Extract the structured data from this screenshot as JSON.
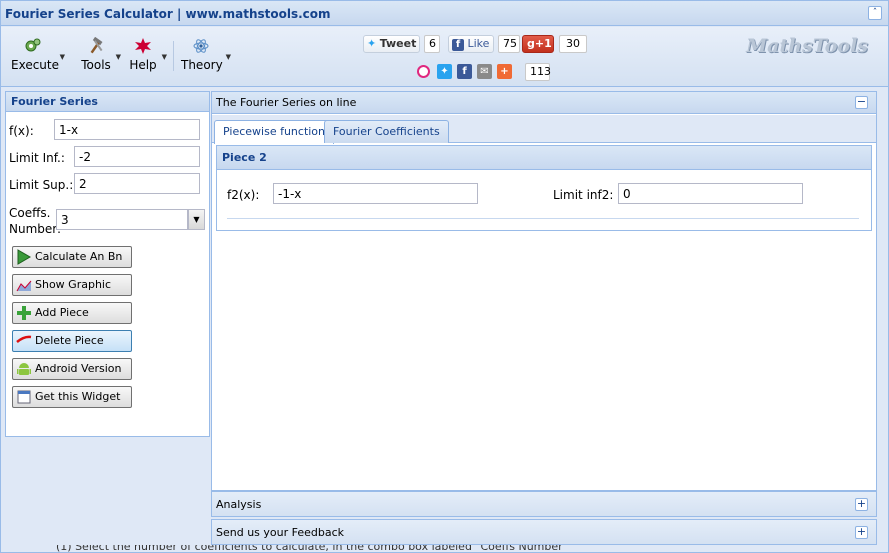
{
  "window": {
    "title": "Fourier Series Calculator | www.mathstools.com"
  },
  "toolbar": {
    "buttons": [
      {
        "label": "Execute",
        "icon": "execute-gears-icon"
      },
      {
        "label": "Tools",
        "icon": "tools-hammer-icon"
      },
      {
        "label": "Help",
        "icon": "help-burst-icon"
      },
      {
        "label": "Theory",
        "icon": "theory-atom-icon"
      }
    ]
  },
  "social": {
    "tweet_label": "Tweet",
    "tweet_count": "6",
    "like_label": "Like",
    "like_count": "75",
    "gplus_label": "+1",
    "gplus_count": "30",
    "share_count": "113"
  },
  "logo": {
    "text": "MathsTools"
  },
  "left": {
    "title": "Fourier Series",
    "fx_label": "f(x):",
    "fx_value": "1-x",
    "inf_label": "Limit Inf.:",
    "inf_value": "-2",
    "sup_label": "Limit Sup.:",
    "sup_value": "2",
    "coeffs_label_1": "Coeffs.",
    "coeffs_label_2": "Number:",
    "coeffs_value": "3",
    "buttons": [
      "Calculate An Bn",
      "Show Graphic",
      "Add Piece",
      "Delete Piece",
      "Android Version",
      "Get this Widget"
    ]
  },
  "main": {
    "title": "The Fourier Series on line",
    "tabs": [
      "Piecewise function",
      "Fourier Coefficients"
    ],
    "piece": {
      "title": "Piece 2",
      "f2_label": "f2(x):",
      "f2_value": "-1-x",
      "inf2_label": "Limit inf2:",
      "inf2_value": "0"
    }
  },
  "accordion": {
    "analysis": "Analysis",
    "feedback": "Send us your Feedback"
  },
  "footer": {
    "text": "(1) Select the number of coefficients to calculate, in the combo box labeled \"Coeffs Number\""
  },
  "colors": {
    "header_text": "#15428b",
    "border": "#99bbe8",
    "panel_bg": "#dfe8f6"
  }
}
